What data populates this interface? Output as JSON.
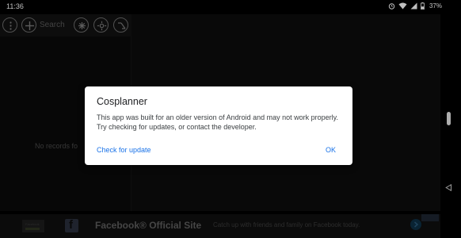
{
  "status_bar": {
    "time": "11:36",
    "battery": "37%",
    "icons": [
      "alarm-icon",
      "wifi-icon",
      "signal-icon",
      "battery-icon"
    ]
  },
  "app": {
    "search_placeholder": "Search",
    "empty_message": "No records fo",
    "toolbar_icons": [
      "more-vert-icon",
      "add-icon",
      "clear-all-icon",
      "settings-icon",
      "sort-icon"
    ]
  },
  "dialog": {
    "title": "Cosplanner",
    "message": "This app was built for an older version of Android and may not work properly. Try checking for updates, or contact the developer.",
    "check_label": "Check for update",
    "ok_label": "OK"
  },
  "ad": {
    "thumb_text": "Facebook",
    "title": "Facebook® Official Site",
    "description": "Catch up with friends and family on Facebook today."
  },
  "colors": {
    "dialog_accent": "#1a73e8",
    "dialog_bg": "#ffffff",
    "app_bg": "#0c0c0c"
  }
}
